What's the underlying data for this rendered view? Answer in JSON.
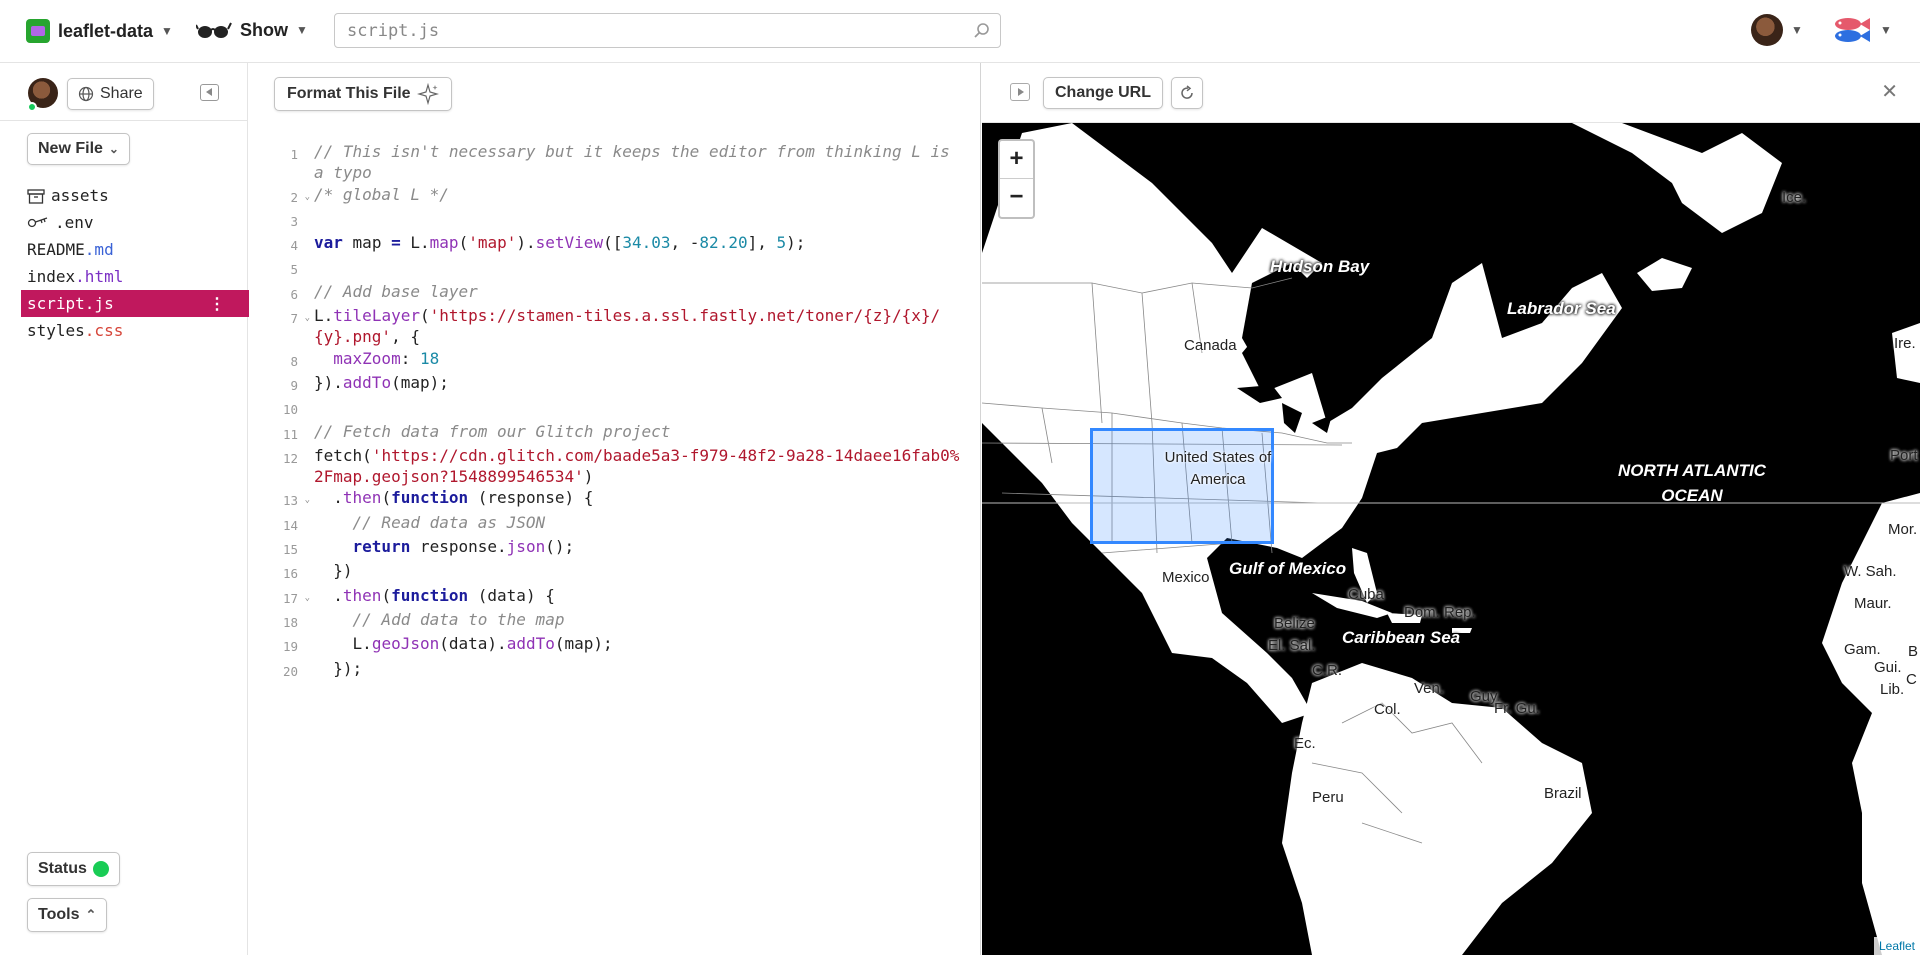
{
  "topbar": {
    "project_name": "leaflet-data",
    "show_label": "Show",
    "search_placeholder": "script.js"
  },
  "sidebar": {
    "share_label": "Share",
    "new_file_label": "New File",
    "files": [
      {
        "name": "assets",
        "ext": "",
        "icon": "archive-icon"
      },
      {
        "name": ".env",
        "ext": "",
        "icon": "key-icon"
      },
      {
        "name": "README",
        "ext": ".md"
      },
      {
        "name": "index",
        "ext": ".html"
      },
      {
        "name": "script",
        "ext": ".js",
        "selected": true
      },
      {
        "name": "styles",
        "ext": ".css"
      }
    ],
    "status_label": "Status",
    "tools_label": "Tools"
  },
  "editor": {
    "format_label": "Format This File",
    "lines": [
      {
        "n": "1",
        "fold": false,
        "text": "// This isn't necessary but it keeps the editor from thinking L is a typo"
      },
      {
        "n": "2",
        "fold": true,
        "text": "/* global L */"
      },
      {
        "n": "3",
        "fold": false,
        "text": ""
      },
      {
        "n": "4",
        "fold": false,
        "text": "var map = L.map('map').setView([34.03, -82.20], 5);"
      },
      {
        "n": "5",
        "fold": false,
        "text": ""
      },
      {
        "n": "6",
        "fold": false,
        "text": "// Add base layer"
      },
      {
        "n": "7",
        "fold": true,
        "text": "L.tileLayer('https://stamen-tiles.a.ssl.fastly.net/toner/{z}/{x}/{y}.png', {"
      },
      {
        "n": "8",
        "fold": false,
        "text": "  maxZoom: 18"
      },
      {
        "n": "9",
        "fold": false,
        "text": "}).addTo(map);"
      },
      {
        "n": "10",
        "fold": false,
        "text": ""
      },
      {
        "n": "11",
        "fold": false,
        "text": "// Fetch data from our Glitch project"
      },
      {
        "n": "12",
        "fold": false,
        "text": "fetch('https://cdn.glitch.com/baade5a3-f979-48f2-9a28-14daee16fab0%2Fmap.geojson?1548899546534')"
      },
      {
        "n": "13",
        "fold": true,
        "text": "  .then(function (response) {"
      },
      {
        "n": "14",
        "fold": false,
        "text": "    // Read data as JSON"
      },
      {
        "n": "15",
        "fold": false,
        "text": "    return response.json();"
      },
      {
        "n": "16",
        "fold": false,
        "text": "  })"
      },
      {
        "n": "17",
        "fold": true,
        "text": "  .then(function (data) {"
      },
      {
        "n": "18",
        "fold": false,
        "text": "    // Add data to the map"
      },
      {
        "n": "19",
        "fold": false,
        "text": "    L.geoJson(data).addTo(map);"
      },
      {
        "n": "20",
        "fold": false,
        "text": "  });"
      }
    ]
  },
  "preview": {
    "change_url_label": "Change URL",
    "zoom_in": "+",
    "zoom_out": "−",
    "attribution": "Leaflet",
    "labels": {
      "ice": "Ice.",
      "hudson_bay": "Hudson Bay",
      "labrador_sea": "Labrador Sea",
      "ire": "Ire.",
      "canada": "Canada",
      "usa": "United States of America",
      "north_atlantic": "NORTH ATLANTIC OCEAN",
      "port": "Port",
      "mor": "Mor.",
      "w_sah": "W. Sah.",
      "maur": "Maur.",
      "gulf_mexico": "Gulf of Mexico",
      "mexico": "Mexico",
      "cuba": "Cuba",
      "dom_rep": "Dom. Rep.",
      "belize": "Belize",
      "el_sal": "El. Sal.",
      "caribbean": "Caribbean Sea",
      "cr": "C.R.",
      "ven": "Ven.",
      "guy": "Guy.",
      "fr_gu": "Fr. Gu.",
      "col": "Col.",
      "ec": "Ec.",
      "gam": "Gam.",
      "gui": "Gui.",
      "lib": "Lib.",
      "b": "B",
      "c": "C",
      "peru": "Peru",
      "brazil": "Brazil"
    }
  }
}
